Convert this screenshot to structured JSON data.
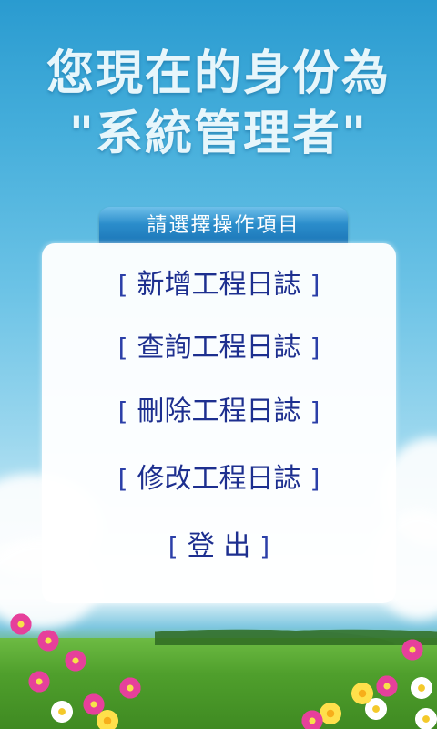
{
  "header": {
    "title_line1": "您現在的身份為",
    "title_line2": "\"系統管理者\""
  },
  "menu": {
    "tab_label": "請選擇操作項目",
    "bracket_open": "[",
    "bracket_close": "]",
    "items": [
      {
        "label": "新增工程日誌"
      },
      {
        "label": "查詢工程日誌"
      },
      {
        "label": "刪除工程日誌"
      },
      {
        "label": "修改工程日誌"
      },
      {
        "label": "登 出"
      }
    ]
  },
  "colors": {
    "sky_top": "#2a9bd0",
    "tab_blue": "#1a74b6",
    "item_text": "#1d2f8f",
    "title_text": "#e7f6fb"
  }
}
